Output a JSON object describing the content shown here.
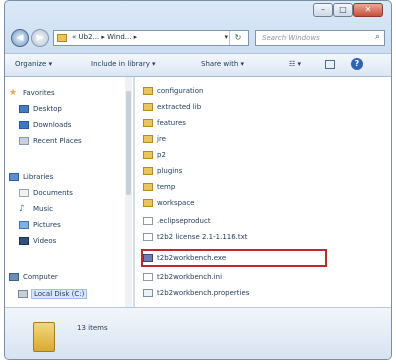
{
  "window": {
    "controls": {
      "minimize": "–",
      "maximize": "□",
      "close": "✕"
    }
  },
  "address": {
    "crumbs": "« Ub2... ▸ Wind... ▸",
    "dropdown": "▾",
    "refresh": "↻"
  },
  "search": {
    "placeholder": "Search Windows",
    "icon": "search-icon"
  },
  "toolbar": {
    "organize": "Organize ▾",
    "include": "Include in library ▾",
    "share": "Share with ▾",
    "views": "☷ ▾",
    "help": "?"
  },
  "nav": {
    "favorites": "Favorites",
    "desktop": "Desktop",
    "downloads": "Downloads",
    "recent": "Recent Places",
    "libraries": "Libraries",
    "documents": "Documents",
    "music": "Music",
    "pictures": "Pictures",
    "videos": "Videos",
    "computer": "Computer",
    "localdisk": "Local Disk (C:)"
  },
  "files": [
    {
      "name": "configuration",
      "type": "folder"
    },
    {
      "name": "extracted lib",
      "type": "folder"
    },
    {
      "name": "features",
      "type": "folder"
    },
    {
      "name": "jre",
      "type": "folder"
    },
    {
      "name": "p2",
      "type": "folder"
    },
    {
      "name": "plugins",
      "type": "folder"
    },
    {
      "name": "temp",
      "type": "folder"
    },
    {
      "name": "workspace",
      "type": "folder"
    },
    {
      "name": ".eclipseproduct",
      "type": "doc"
    },
    {
      "name": "t2b2 license 2.1-1.116.txt",
      "type": "doc"
    },
    {
      "name": "t2b2workbench.exe",
      "type": "exe"
    },
    {
      "name": "t2b2workbench.ini",
      "type": "doc"
    },
    {
      "name": "t2b2workbench.properties",
      "type": "prop"
    }
  ],
  "details": {
    "count": "13 items"
  }
}
